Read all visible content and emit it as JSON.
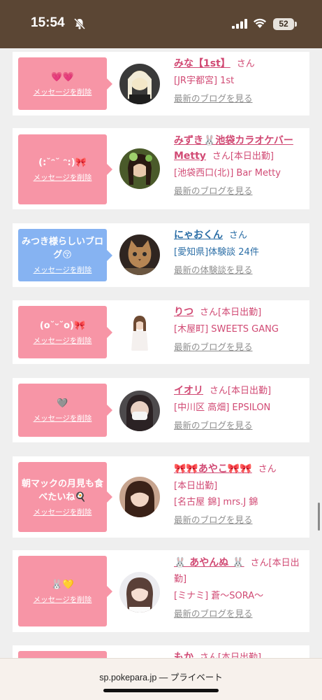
{
  "status_bar": {
    "time": "15:54",
    "battery": "52",
    "icons": [
      "bell-off-icon",
      "signal-icon",
      "wifi-icon",
      "battery-icon"
    ]
  },
  "colors": {
    "status_bg": "#5b4634",
    "pink_bubble": "#f795a6",
    "blue_bubble": "#86b3f2",
    "pink_text": "#d14a74",
    "blue_text": "#2b6ea6",
    "link_gray": "#8e8e8e"
  },
  "delete_label": "メッセージを削除",
  "cards": [
    {
      "message": "💗💗",
      "name": "みな【1st】",
      "suffix": "さん",
      "shop": "[JR宇都宮] 1st",
      "link": "最新のブログを見る"
    },
    {
      "message": "(:˘ᵔ˘ ᵔ:)🎀",
      "name": "みずき🐰池袋カラオケバーMetty",
      "suffix": "さん[本日出勤]",
      "shop": "[池袋西口(北)] Bar Metty",
      "link": "最新のブログを見る"
    },
    {
      "message": "みつき様らしいブログ😚",
      "name": "にゃおくん",
      "suffix": "さん",
      "shop": "[愛知県]体験談 24件",
      "link": "最新の体験談を見る"
    },
    {
      "message": "(o˘ᵕ˘o)🎀",
      "name": "りつ",
      "suffix": "さん[本日出勤]",
      "shop": "[木屋町] SWEETS GANG",
      "link": "最新のブログを見る"
    },
    {
      "message": "🩶",
      "name": "イオリ",
      "suffix": "さん[本日出勤]",
      "shop": "[中川区 高畑] EPSILON",
      "link": "最新のブログを見る"
    },
    {
      "message": "朝マックの月見も食べたいね🍳",
      "name": "🎀🎀あやこ🎀🎀",
      "suffix": "さん",
      "status": "[本日出勤]",
      "shop": "[名古屋 錦] mrs.J 錦",
      "link": "最新のブログを見る"
    },
    {
      "message": "🐰💛",
      "name": "🐰 あやんぬ 🐰",
      "suffix": "さん[本日出勤]",
      "shop": "[ミナミ] 蒼〜SORA〜",
      "link": "最新のブログを見る"
    },
    {
      "name": "もか",
      "suffix": "さん[本日出勤]"
    }
  ],
  "browser": {
    "url": "sp.pokepara.jp — プライベート"
  }
}
